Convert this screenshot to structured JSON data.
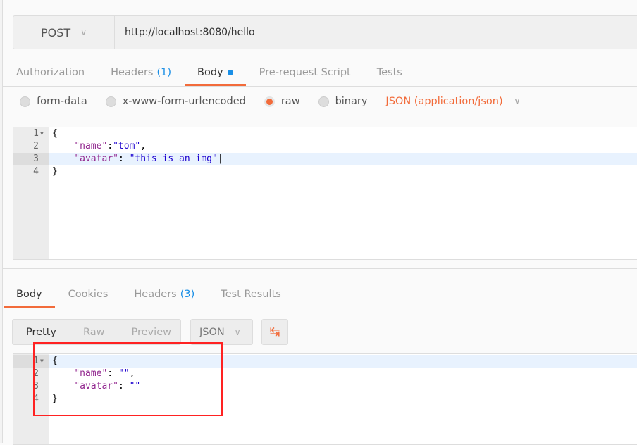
{
  "request": {
    "method": "POST",
    "url": "http://localhost:8080/hello",
    "tabs": [
      {
        "label": "Authorization"
      },
      {
        "label": "Headers",
        "count": "(1)"
      },
      {
        "label": "Body"
      },
      {
        "label": "Pre-request Script"
      },
      {
        "label": "Tests"
      }
    ],
    "body_modes": [
      "form-data",
      "x-www-form-urlencoded",
      "raw",
      "binary"
    ],
    "selected_mode": "raw",
    "content_type": "JSON (application/json)",
    "lines": [
      "1",
      "2",
      "3",
      "4"
    ]
  },
  "response": {
    "tabs": [
      {
        "label": "Body"
      },
      {
        "label": "Cookies"
      },
      {
        "label": "Headers",
        "count": "(3)"
      },
      {
        "label": "Test Results"
      }
    ],
    "views": [
      "Pretty",
      "Raw",
      "Preview"
    ],
    "format": "JSON",
    "lines": [
      "1",
      "2",
      "3",
      "4"
    ]
  },
  "colors": {
    "accent": "#f26b3a",
    "count": "#1a8fe6",
    "highlight_box": "#ff2222"
  }
}
